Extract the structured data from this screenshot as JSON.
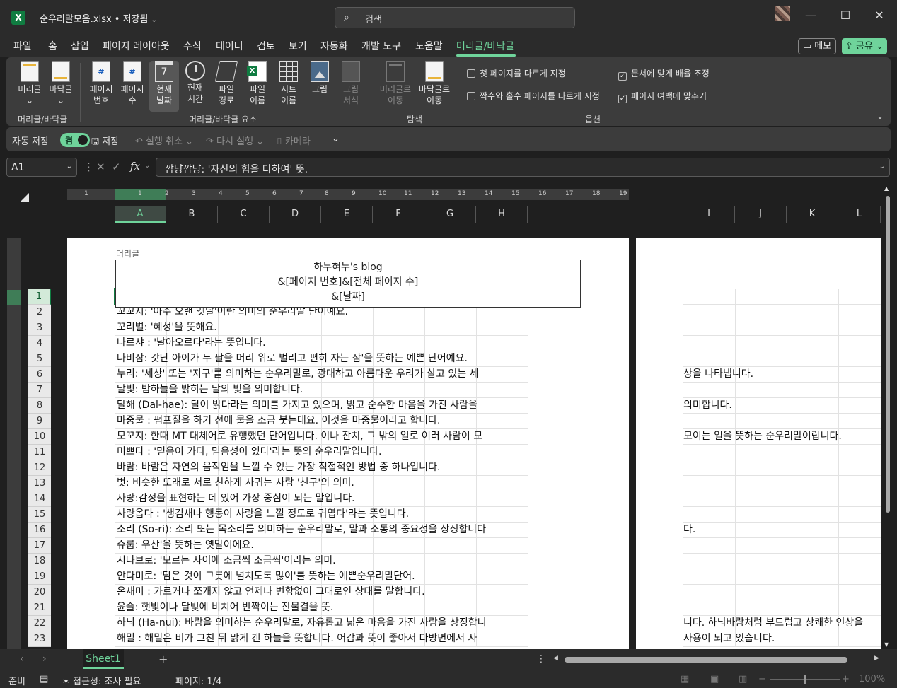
{
  "window": {
    "app_icon": "excel-logo",
    "file_title": "순우리말모음.xlsx • 저장됨",
    "search_placeholder": "검색",
    "controls": [
      "minimize-icon",
      "maximize-icon",
      "close-icon"
    ]
  },
  "menu": {
    "tabs": [
      "파일",
      "홈",
      "삽입",
      "페이지 레이아웃",
      "수식",
      "데이터",
      "검토",
      "보기",
      "자동화",
      "개발 도구",
      "도움말",
      "머리글/바닥글"
    ],
    "active": "머리글/바닥글",
    "memo_label": "메모",
    "share_label": "공유"
  },
  "ribbon": {
    "group1": {
      "label": "머리글/바닥글",
      "buttons": [
        {
          "l1": "머리글",
          "l2": "⌄"
        },
        {
          "l1": "바닥글",
          "l2": "⌄"
        }
      ]
    },
    "group2": {
      "label": "머리글/바닥글 요소",
      "buttons": [
        {
          "l1": "페이지",
          "l2": "번호"
        },
        {
          "l1": "페이지",
          "l2": "수"
        },
        {
          "l1": "현재",
          "l2": "날짜"
        },
        {
          "l1": "현재",
          "l2": "시간"
        },
        {
          "l1": "파일",
          "l2": "경로"
        },
        {
          "l1": "파일",
          "l2": "이름"
        },
        {
          "l1": "시트",
          "l2": "이름"
        },
        {
          "l1": "그림",
          "l2": ""
        },
        {
          "l1": "그림",
          "l2": "서식"
        }
      ]
    },
    "group3": {
      "label": "탐색",
      "buttons": [
        {
          "l1": "머리글로",
          "l2": "이동"
        },
        {
          "l1": "바닥글로",
          "l2": "이동"
        }
      ]
    },
    "group4": {
      "label": "옵션",
      "options": [
        {
          "label": "첫 페이지를 다르게 지정",
          "checked": false
        },
        {
          "label": "짝수와 홀수 페이지를 다르게 지정",
          "checked": false
        },
        {
          "label": "문서에 맞게 배율 조정",
          "checked": true
        },
        {
          "label": "페이지 여백에 맞추기",
          "checked": true
        }
      ]
    }
  },
  "qat": {
    "autosave_label": "자동 저장",
    "toggle_label": "켬",
    "save_label": "저장",
    "undo_label": "실행 취소",
    "redo_label": "다시 실행",
    "camera_label": "카메라"
  },
  "formula_bar": {
    "name_box": "A1",
    "fx": "fx",
    "content": "깜냥깜냥: '자신의 힘을 다하여' 뜻."
  },
  "ruler_ticks": [
    "1",
    "1",
    "2",
    "3",
    "4",
    "5",
    "6",
    "7",
    "8",
    "9",
    "10",
    "11",
    "12",
    "13",
    "14",
    "15",
    "16",
    "17",
    "18",
    "19"
  ],
  "columns": [
    "A",
    "B",
    "C",
    "D",
    "E",
    "F",
    "G",
    "H",
    "I",
    "J",
    "K",
    "L"
  ],
  "page_header": {
    "label": "머리글",
    "line1": "하누혀누's blog",
    "line2": "&[페이지 번호]&[전체 페이지 수]",
    "line3": "&[날짜]"
  },
  "rows": [
    {
      "num": "1",
      "left": "",
      "right": ""
    },
    {
      "num": "2",
      "left": "꼬꼬지: '아주 오랜 옛날'이란 의미의 순우리말 단어예요.",
      "right": ""
    },
    {
      "num": "3",
      "left": "꼬리별: '혜성'을 뜻해요.",
      "right": ""
    },
    {
      "num": "4",
      "left": "나르샤 :  '날아오르다'라는 뜻입니다.",
      "right": ""
    },
    {
      "num": "5",
      "left": "나비잠: 갓난 아이가 두 팔을 머리 위로 벌리고 편히 자는 잠'을 뜻하는 예쁜 단어예요.",
      "right": ""
    },
    {
      "num": "6",
      "left": "누리: '세상' 또는 '지구'를 의미하는 순우리말로, 광대하고 아름다운 우리가 살고 있는 세",
      "right": "상을 나타냅니다."
    },
    {
      "num": "7",
      "left": "달빛: 밤하늘을 밝히는 달의 빛을 의미합니다.",
      "right": ""
    },
    {
      "num": "8",
      "left": "달해 (Dal-hae): 달이 밝다라는 의미를 가지고 있으며, 밝고 순수한 마음을 가진 사람을 ",
      "right": "의미합니다."
    },
    {
      "num": "9",
      "left": "마중물 :  펌프질을 하기 전에 물을 조금 붓는데요. 이것을 마중물이라고 합니다.",
      "right": ""
    },
    {
      "num": "10",
      "left": "모꼬지: 한때 MT 대체어로 유행했던 단어입니다. 이나 잔치, 그 밖의 일로 여러 사람이 모",
      "right": "모이는 일을 뜻하는 순우리말이랍니다."
    },
    {
      "num": "11",
      "left": "미쁘다 :  '믿음이 가다, 믿음성이 있다'라는 뜻의 순우리말입니다.",
      "right": ""
    },
    {
      "num": "12",
      "left": "바람: 바람은 자연의 움직임을 느낄 수 있는 가장 직접적인 방법 중 하나입니다.",
      "right": ""
    },
    {
      "num": "13",
      "left": "벗: 비슷한 또래로 서로 친하게 사귀는 사람 '친구'의 의미.",
      "right": ""
    },
    {
      "num": "14",
      "left": "사랑:감정을 표현하는 데 있어 가장 중심이 되는 말입니다.",
      "right": ""
    },
    {
      "num": "15",
      "left": "사랑옵다 :  '생김새나 행동이 사랑을 느낄 정도로 귀엽다'라는 뜻입니다.",
      "right": ""
    },
    {
      "num": "16",
      "left": "소리 (So-ri): 소리 또는 목소리를 의미하는 순우리말로, 말과 소통의 중요성을 상징합니다",
      "right": "다."
    },
    {
      "num": "17",
      "left": "슈룹: 우산'을 뜻하는 옛말이에요.",
      "right": ""
    },
    {
      "num": "18",
      "left": "시나브로: '모르는 사이에 조금씩 조금씩'이라는 의미.",
      "right": ""
    },
    {
      "num": "19",
      "left": "안다미로: '담은 것이 그릇에 넘치도록 많이'를 뜻하는 예쁜순우리말단어.",
      "right": ""
    },
    {
      "num": "20",
      "left": "온새미 :  가르거나 쪼개지 않고 언제나 변함없이 그대로인 상태를 말합니다.",
      "right": ""
    },
    {
      "num": "21",
      "left": "윤슬: 햇빛이나 달빛에 비치어 반짝이는 잔물결을 뜻.",
      "right": ""
    },
    {
      "num": "22",
      "left": "하늬 (Ha-nui): 바람을 의미하는 순우리말로, 자유롭고 넓은 마음을 가진 사람을 상징합니",
      "right": "니다. 하늬바람처럼 부드럽고 상쾌한 인상을"
    },
    {
      "num": "23",
      "left": "해밀 :  해밀은 비가 그친 뒤 맑게 갠 하늘을 뜻합니다. 어감과 뜻이 좋아서 다방면에서 사",
      "right": "사용이 되고 있습니다."
    }
  ],
  "sheet_tabs": {
    "active": "Sheet1",
    "add": "+"
  },
  "status": {
    "ready": "준비",
    "accessibility": "접근성: 조사 필요",
    "page": "페이지: 1/4",
    "zoom": "100%"
  },
  "colors": {
    "accent": "#6fd49b",
    "excel_green": "#107c41"
  }
}
